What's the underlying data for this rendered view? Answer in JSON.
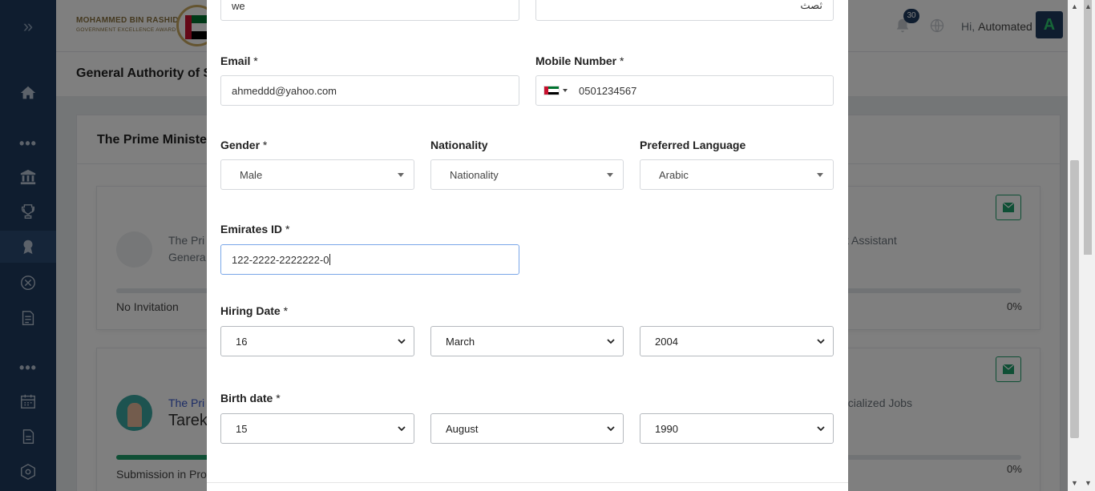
{
  "logo": {
    "line1": "MOHAMMED BIN RASHID",
    "line2": "GOVERNMENT EXCELLENCE AWARD"
  },
  "header": {
    "notification_count": "30",
    "greeting": "Hi,",
    "user_name": "Automated",
    "avatar_letter": "A"
  },
  "page": {
    "title": "General Authority of S"
  },
  "card": {
    "title": "The Prime Minister"
  },
  "background_items": [
    {
      "title_start": "The Pri",
      "title_line2_start": "Genera",
      "right_text": "t Assistant",
      "status": "No Invitation",
      "percent": "0%",
      "progress": 0
    },
    {
      "title_start": "The Pri",
      "name_start": "Tarek",
      "right_text": "ecialized Jobs",
      "status": "Submission in Prog",
      "percent": "0%",
      "progress": 0.25
    }
  ],
  "form": {
    "name_en_value": "we",
    "name_ar_value": "ثصث",
    "email": {
      "label": "Email",
      "required": "*",
      "value": "ahmeddd@yahoo.com"
    },
    "mobile": {
      "label": "Mobile Number",
      "required": "*",
      "value": "0501234567",
      "country": "uae-flag-icon"
    },
    "gender": {
      "label": "Gender",
      "required": "*",
      "value": "Male"
    },
    "nationality": {
      "label": "Nationality",
      "value": "Nationality"
    },
    "language": {
      "label": "Preferred Language",
      "value": "Arabic"
    },
    "emirates_id": {
      "label": "Emirates ID",
      "required": "*",
      "value": "122-2222-2222222-0"
    },
    "hiring_date": {
      "label": "Hiring Date",
      "required": "*",
      "day": "16",
      "month": "March",
      "year": "2004"
    },
    "birth_date": {
      "label": "Birth date",
      "required": "*",
      "day": "15",
      "month": "August",
      "year": "1990"
    }
  },
  "colors": {
    "sidebar": "#1f3b5f",
    "accent_green": "#1e9e6a",
    "focus_border": "#7aa7e8"
  }
}
